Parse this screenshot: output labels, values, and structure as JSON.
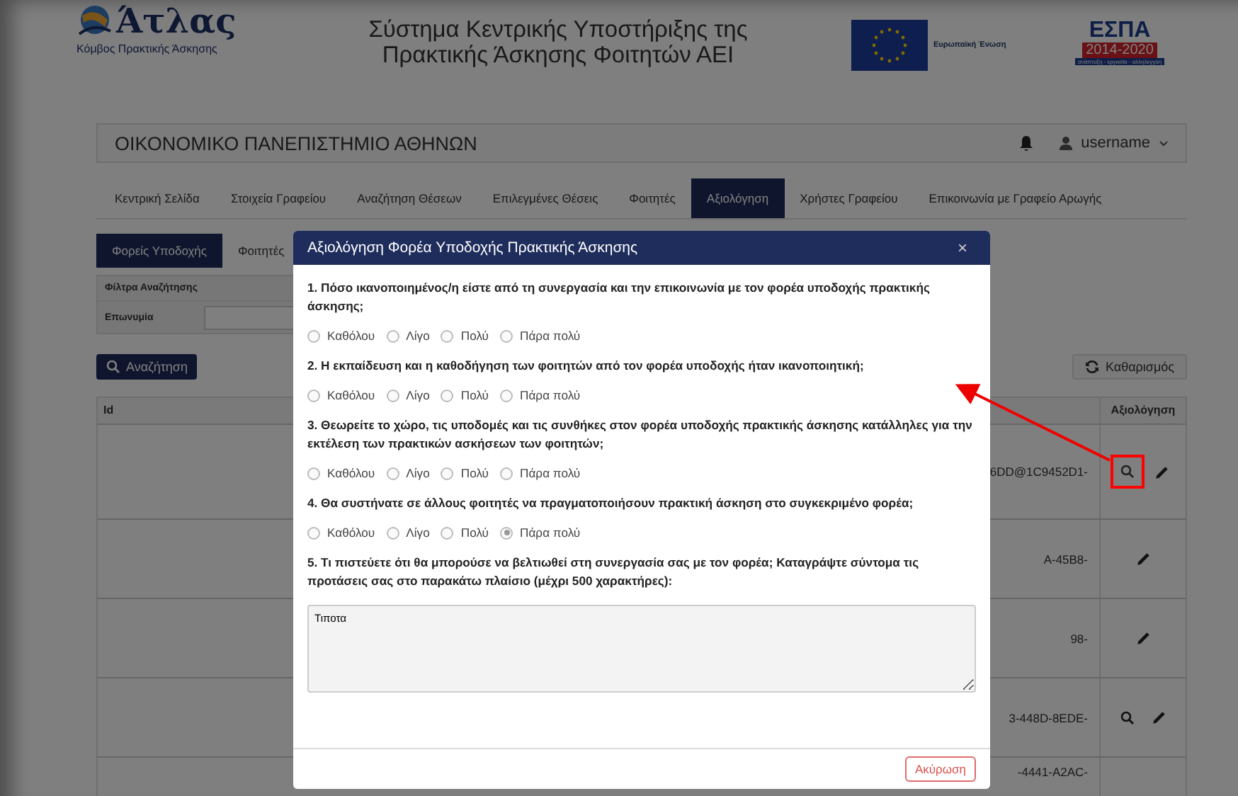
{
  "header": {
    "logo": {
      "name": "Άτλας",
      "subtitle": "Κόμβος Πρακτικής Άσκησης"
    },
    "title_lines": [
      "Σύστημα Κεντρικής Υποστήριξης της",
      "Πρακτικής Άσκησης Φοιτητών ΑΕΙ"
    ],
    "eu": {
      "label": "Ευρωπαϊκή Ένωση"
    },
    "espa": {
      "name": "ΕΣΠΑ",
      "years": "2014-2020",
      "slogan": "ανάπτυξη - εργασία - αλληλεγγύη"
    }
  },
  "topbar": {
    "institution": "ΟΙΚΟΝΟΜΙΚΟ ΠΑΝΕΠΙΣΤΗΜΙΟ ΑΘΗΝΩΝ",
    "user": "username"
  },
  "nav": [
    {
      "label": "Κεντρική Σελίδα",
      "selected": false
    },
    {
      "label": "Στοιχεία Γραφείου",
      "selected": false
    },
    {
      "label": "Αναζήτηση Θέσεων",
      "selected": false
    },
    {
      "label": "Επιλεγμένες Θέσεις",
      "selected": false
    },
    {
      "label": "Φοιτητές",
      "selected": false
    },
    {
      "label": "Αξιολόγηση",
      "selected": true
    },
    {
      "label": "Χρήστες Γραφείου",
      "selected": false
    },
    {
      "label": "Επικοινωνία με Γραφείο Αρωγής",
      "selected": false
    }
  ],
  "subtabs": [
    {
      "label": "Φορείς Υποδοχής",
      "selected": true
    },
    {
      "label": "Φοιτητές",
      "selected": false
    }
  ],
  "filters": {
    "title": "Φίλτρα Αναζήτησης",
    "field_label": "Επωνυμία"
  },
  "search_button": "Αναζήτηση",
  "clear_button": "Καθαρισμός",
  "table": {
    "columns": [
      "Id",
      "Αξιολόγηση"
    ],
    "rows": [
      {
        "text": "6DD@1C9452D1-",
        "actions": [
          {
            "kind": "view",
            "highlighted": true
          },
          {
            "kind": "edit",
            "highlighted": false
          }
        ]
      },
      {
        "text": "A-45B8-",
        "actions": [
          {
            "kind": "edit",
            "highlighted": false
          }
        ]
      },
      {
        "text": "98-",
        "actions": [
          {
            "kind": "edit",
            "highlighted": false
          }
        ]
      },
      {
        "text": "3-448D-8EDE-",
        "actions": [
          {
            "kind": "view",
            "highlighted": false
          },
          {
            "kind": "edit",
            "highlighted": false
          }
        ]
      },
      {
        "text": "-4441-A2AC-",
        "actions": []
      }
    ]
  },
  "modal": {
    "title": "Αξιολόγηση Φορέα Υποδοχής Πρακτικής Άσκησης",
    "close": "×",
    "questions": [
      {
        "text": "1. Πόσο ικανοποιημένος/η είστε από τη συνεργασία και την επικοινωνία με τον φορέα υποδοχής πρακτικής άσκησης;",
        "options": [
          {
            "label": "Καθόλου",
            "selected": false
          },
          {
            "label": "Λίγο",
            "selected": false
          },
          {
            "label": "Πολύ",
            "selected": false
          },
          {
            "label": "Πάρα πολύ",
            "selected": false
          }
        ]
      },
      {
        "text": "2. Η εκπαίδευση και η καθοδήγηση των φοιτητών από τον φορέα υποδοχής ήταν ικανοποιητική;",
        "options": [
          {
            "label": "Καθόλου",
            "selected": false
          },
          {
            "label": "Λίγο",
            "selected": false
          },
          {
            "label": "Πολύ",
            "selected": false
          },
          {
            "label": "Πάρα πολύ",
            "selected": false
          }
        ]
      },
      {
        "text": "3. Θεωρείτε το χώρο, τις υποδομές και τις συνθήκες στον φορέα υποδοχής πρακτικής άσκησης κατάλληλες για την εκτέλεση των πρακτικών ασκήσεων των φοιτητών;",
        "options": [
          {
            "label": "Καθόλου",
            "selected": false
          },
          {
            "label": "Λίγο",
            "selected": false
          },
          {
            "label": "Πολύ",
            "selected": false
          },
          {
            "label": "Πάρα πολύ",
            "selected": false
          }
        ]
      },
      {
        "text": "4. Θα συστήνατε σε άλλους φοιτητές να πραγματοποιήσουν πρακτική άσκηση στο συγκεκριμένο φορέα;",
        "options": [
          {
            "label": "Καθόλου",
            "selected": false
          },
          {
            "label": "Λίγο",
            "selected": false
          },
          {
            "label": "Πολύ",
            "selected": false
          },
          {
            "label": "Πάρα πολύ",
            "selected": true
          }
        ]
      }
    ],
    "comment": {
      "question": "5. Τι πιστεύετε ότι θα μπορούσε να βελτιωθεί στη συνεργασία σας με τον φορέα; Καταγράψτε σύντομα τις προτάσεις σας στο παρακάτω πλαίσιο (μέχρι 500 χαρακτήρες):",
      "value": "Τιποτα"
    },
    "cancel": "Ακύρωση"
  }
}
